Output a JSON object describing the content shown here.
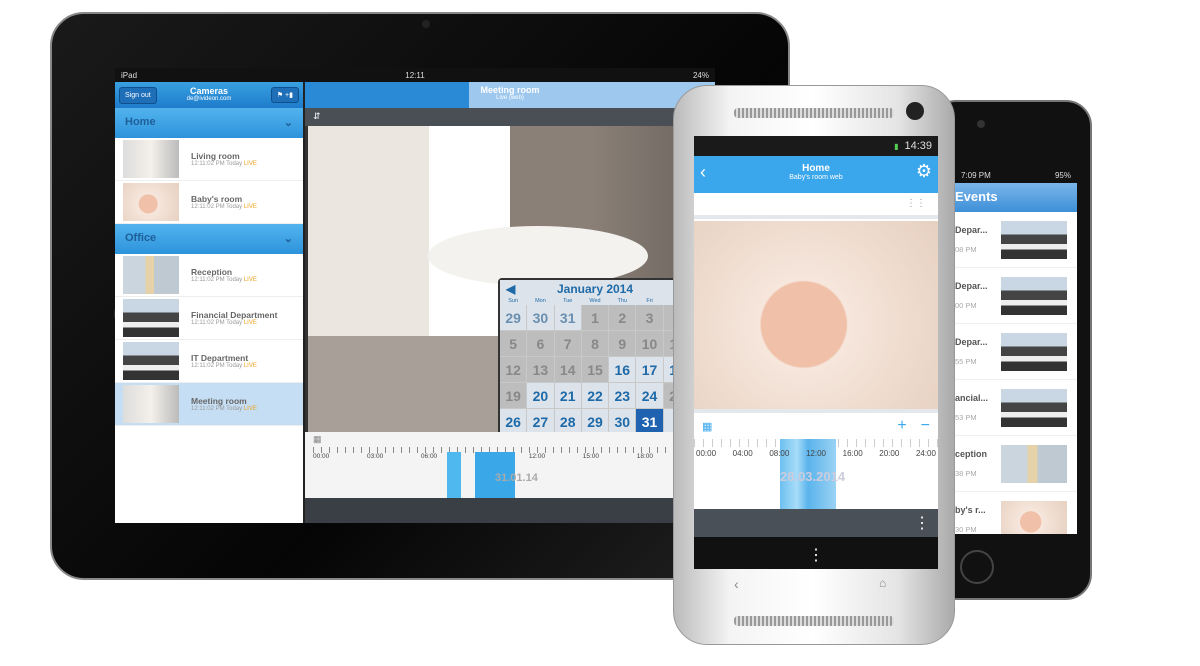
{
  "ipad": {
    "status": {
      "device": "iPad",
      "time": "12:11",
      "battery": "24%"
    },
    "sidebar": {
      "sign_out": "Sign out",
      "title": "Cameras",
      "email": "de@ivideon.com",
      "groups": [
        {
          "name": "Home",
          "cameras": [
            {
              "name": "Living room",
              "time": "12:11:02 PM Today",
              "status": "LIVE",
              "thumb": "room"
            },
            {
              "name": "Baby's room",
              "time": "12:11:02 PM Today",
              "status": "LIVE",
              "thumb": "baby"
            }
          ]
        },
        {
          "name": "Office",
          "cameras": [
            {
              "name": "Reception",
              "time": "12:11:02 PM Today",
              "status": "LIVE",
              "thumb": "recep"
            },
            {
              "name": "Financial Department",
              "time": "12:11:02 PM Today",
              "status": "LIVE",
              "thumb": "office"
            },
            {
              "name": "IT Department",
              "time": "12:11:02 PM Today",
              "status": "LIVE",
              "thumb": "office"
            },
            {
              "name": "Meeting room",
              "time": "12:11:02 PM Today",
              "status": "LIVE",
              "thumb": "room",
              "selected": true
            }
          ]
        }
      ]
    },
    "main": {
      "title": "Meeting room",
      "subtitle": "Live (web)",
      "calendar": {
        "month": "January 2014",
        "weekdays": [
          "Sun",
          "Mon",
          "Tue",
          "Wed",
          "Thu",
          "Fri",
          "Sat"
        ],
        "days": [
          [
            29,
            "o"
          ],
          [
            30,
            "o"
          ],
          [
            31,
            "o"
          ],
          [
            1,
            ""
          ],
          [
            2,
            ""
          ],
          [
            3,
            ""
          ],
          [
            4,
            ""
          ],
          [
            5,
            ""
          ],
          [
            6,
            ""
          ],
          [
            7,
            ""
          ],
          [
            8,
            ""
          ],
          [
            9,
            ""
          ],
          [
            10,
            ""
          ],
          [
            11,
            ""
          ],
          [
            12,
            ""
          ],
          [
            13,
            ""
          ],
          [
            14,
            ""
          ],
          [
            15,
            ""
          ],
          [
            16,
            "a"
          ],
          [
            17,
            "a"
          ],
          [
            18,
            "a"
          ],
          [
            19,
            ""
          ],
          [
            20,
            "a"
          ],
          [
            21,
            "a"
          ],
          [
            22,
            "a"
          ],
          [
            23,
            "a"
          ],
          [
            24,
            "a"
          ],
          [
            25,
            ""
          ],
          [
            26,
            "a"
          ],
          [
            27,
            "a"
          ],
          [
            28,
            "a"
          ],
          [
            29,
            "a"
          ],
          [
            30,
            "a"
          ],
          [
            31,
            "s"
          ],
          [
            1,
            "o"
          ]
        ]
      },
      "timeline": {
        "labels": [
          "00:00",
          "03:00",
          "06:00",
          "09:00",
          "12:00",
          "15:00",
          "18:00",
          "21:00"
        ],
        "date": "31.01.14"
      }
    }
  },
  "android": {
    "status_time": "14:39",
    "title": "Home",
    "subtitle": "Baby's room web",
    "timeline": {
      "labels": [
        "00:00",
        "04:00",
        "08:00",
        "12:00",
        "16:00",
        "20:00",
        "24:00"
      ],
      "date": "28.03.2014"
    }
  },
  "iphone": {
    "status_time": "7:09 PM",
    "battery": "95%",
    "title": "Events",
    "events": [
      {
        "name": "Depar...",
        "time": "08 PM",
        "thumb": "office"
      },
      {
        "name": "Depar...",
        "time": "00 PM",
        "thumb": "office"
      },
      {
        "name": "Depar...",
        "time": "55 PM",
        "thumb": "office"
      },
      {
        "name": "ancial...",
        "time": "53 PM",
        "thumb": "office"
      },
      {
        "name": "ception",
        "time": "38 PM",
        "thumb": "recep"
      },
      {
        "name": "by's r...",
        "time": "30 PM",
        "thumb": "baby"
      }
    ]
  },
  "colors": {
    "accent": "#2d93db",
    "live": "#f0a020",
    "selected_day": "#1e62b0"
  }
}
